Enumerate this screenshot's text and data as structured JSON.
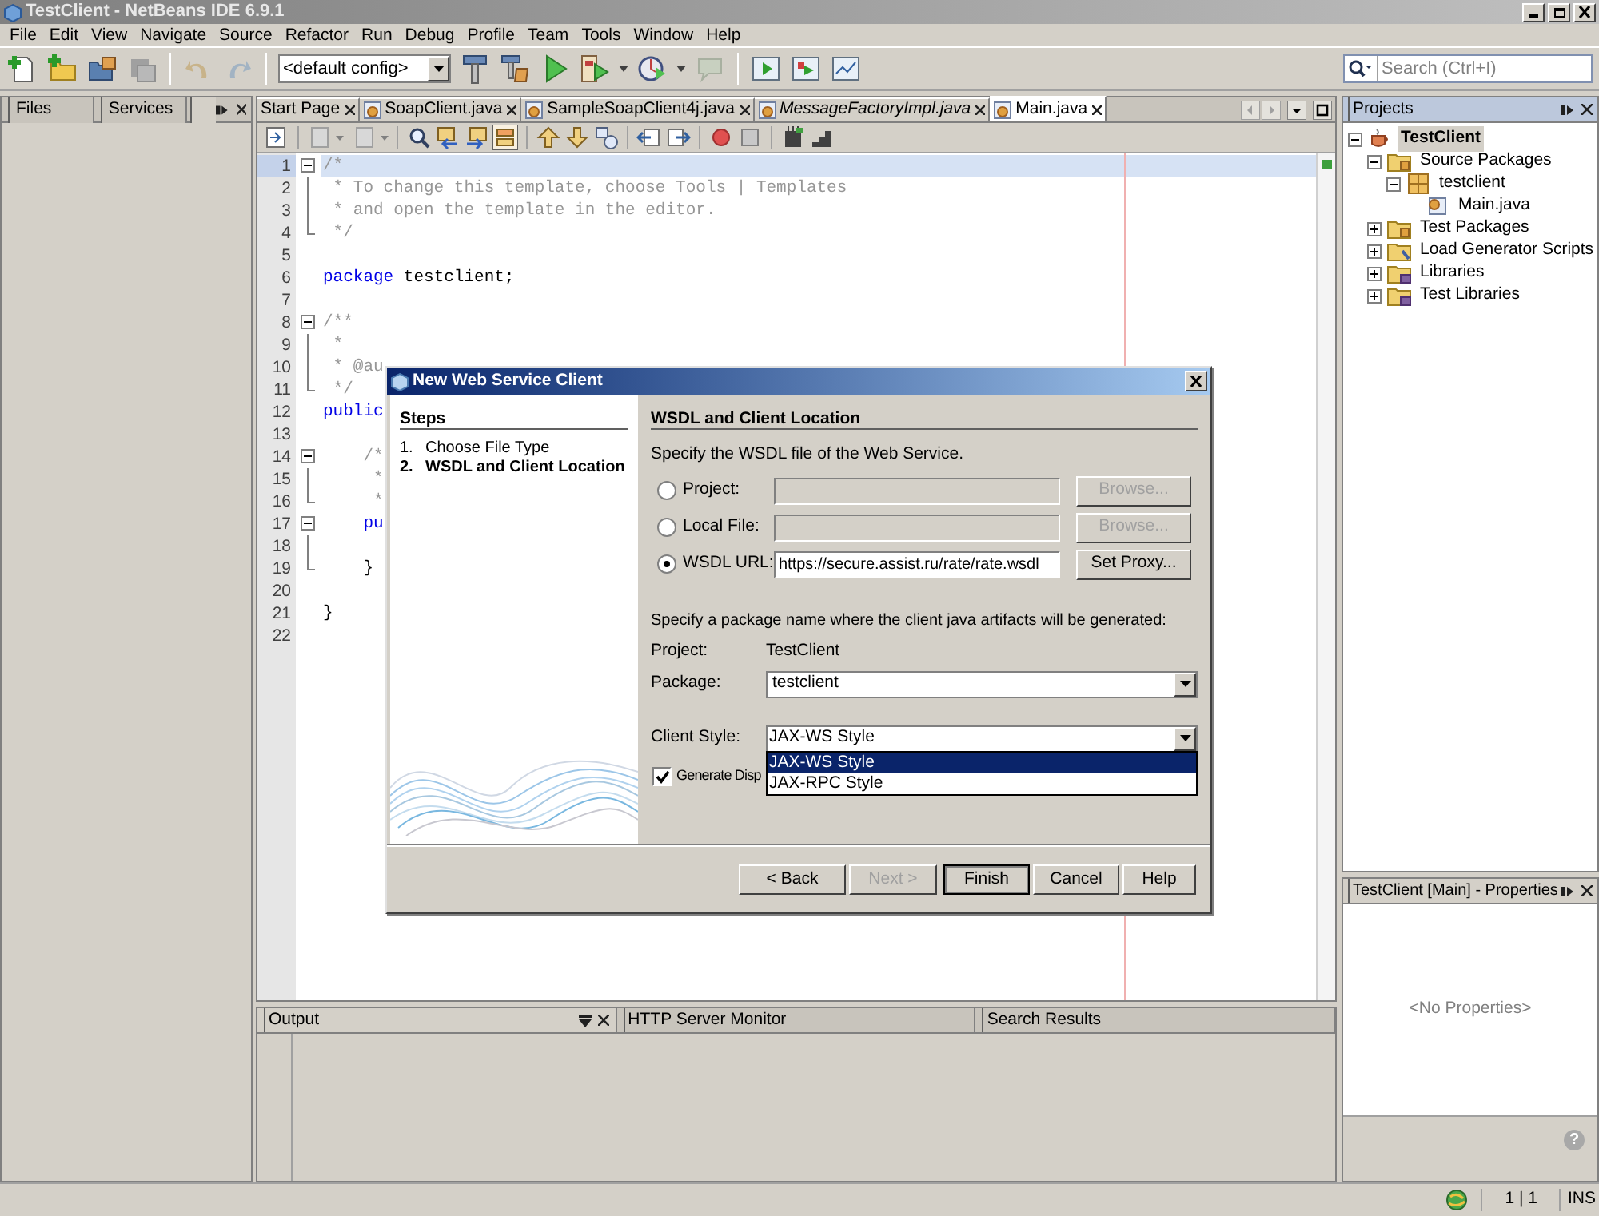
{
  "window": {
    "title": "TestClient - NetBeans IDE 6.9.1"
  },
  "menu": [
    "File",
    "Edit",
    "View",
    "Navigate",
    "Source",
    "Refactor",
    "Run",
    "Debug",
    "Profile",
    "Team",
    "Tools",
    "Window",
    "Help"
  ],
  "toolbar": {
    "config": "<default config>",
    "search_placeholder": "Search (Ctrl+I)"
  },
  "left_panel": {
    "tabs": [
      "Files",
      "Services"
    ]
  },
  "editor": {
    "tabs": [
      {
        "label": "Start Page",
        "italic": false,
        "selected": false,
        "icon": false
      },
      {
        "label": "SoapClient.java",
        "italic": false,
        "selected": false,
        "icon": true
      },
      {
        "label": "SampleSoapClient4j.java",
        "italic": false,
        "selected": false,
        "icon": true
      },
      {
        "label": "MessageFactoryImpl.java",
        "italic": true,
        "selected": false,
        "icon": true
      },
      {
        "label": "Main.java",
        "italic": false,
        "selected": true,
        "icon": true
      }
    ],
    "lines": [
      {
        "number": "1",
        "kind": "fold-start",
        "current": true,
        "tokens": [
          {
            "kind": "comment",
            "text": "/*"
          }
        ]
      },
      {
        "number": "2",
        "kind": "fold-body",
        "current": false,
        "tokens": [
          {
            "kind": "comment",
            "text": " * To change this template, choose Tools | Templates"
          }
        ]
      },
      {
        "number": "3",
        "kind": "fold-body",
        "current": false,
        "tokens": [
          {
            "kind": "comment",
            "text": " * and open the template in the editor."
          }
        ]
      },
      {
        "number": "4",
        "kind": "fold-end",
        "current": false,
        "tokens": [
          {
            "kind": "comment",
            "text": " */"
          }
        ]
      },
      {
        "number": "5",
        "kind": "plain",
        "current": false
      },
      {
        "number": "6",
        "kind": "plain",
        "current": false,
        "tokens": [
          {
            "kind": "keyword",
            "text": "package"
          },
          {
            "kind": "plain",
            "text": " testclient;"
          }
        ]
      },
      {
        "number": "7",
        "kind": "plain",
        "current": false
      },
      {
        "number": "8",
        "kind": "fold-start",
        "current": false,
        "tokens": [
          {
            "kind": "comment",
            "text": "/**"
          }
        ]
      },
      {
        "number": "9",
        "kind": "fold-body",
        "current": false,
        "tokens": [
          {
            "kind": "comment",
            "text": " *"
          }
        ]
      },
      {
        "number": "10",
        "kind": "fold-body",
        "current": false,
        "tokens": [
          {
            "kind": "comment",
            "text": " * @au"
          }
        ]
      },
      {
        "number": "11",
        "kind": "fold-end",
        "current": false,
        "tokens": [
          {
            "kind": "comment",
            "text": " */"
          }
        ]
      },
      {
        "number": "12",
        "kind": "plain",
        "current": false,
        "tokens": [
          {
            "kind": "keyword",
            "text": "public"
          }
        ]
      },
      {
        "number": "13",
        "kind": "plain",
        "current": false
      },
      {
        "number": "14",
        "kind": "fold-start",
        "current": false,
        "tokens": [
          {
            "kind": "comment",
            "text": "    /*"
          }
        ]
      },
      {
        "number": "15",
        "kind": "fold-body",
        "current": false,
        "tokens": [
          {
            "kind": "comment",
            "text": "     *"
          }
        ]
      },
      {
        "number": "16",
        "kind": "fold-end",
        "current": false,
        "tokens": [
          {
            "kind": "comment",
            "text": "     *"
          }
        ]
      },
      {
        "number": "17",
        "kind": "fold-start",
        "current": false,
        "tokens": [
          {
            "kind": "keyword",
            "text": "    pu"
          }
        ]
      },
      {
        "number": "18",
        "kind": "fold-body",
        "current": false
      },
      {
        "number": "19",
        "kind": "fold-end",
        "current": false,
        "tokens": [
          {
            "kind": "plain",
            "text": "    }"
          }
        ]
      },
      {
        "number": "20",
        "kind": "plain",
        "current": false
      },
      {
        "number": "21",
        "kind": "plain",
        "current": false,
        "tokens": [
          {
            "kind": "plain",
            "text": "}"
          }
        ]
      },
      {
        "number": "22",
        "kind": "plain",
        "current": false
      }
    ]
  },
  "output_panel": {
    "tabs": [
      {
        "label": "Output",
        "selected": true
      },
      {
        "label": "HTTP Server Monitor",
        "selected": false
      },
      {
        "label": "Search Results",
        "selected": false
      }
    ]
  },
  "projects": {
    "title": "Projects",
    "tree": [
      {
        "label": "TestClient",
        "kind": "project",
        "selected": true,
        "expanded": true,
        "children": [
          {
            "label": "Source Packages",
            "kind": "source-folder",
            "selected": false,
            "expanded": true,
            "children": [
              {
                "label": "testclient",
                "kind": "package",
                "selected": false,
                "expanded": true,
                "children": [
                  {
                    "label": "Main.java",
                    "kind": "java",
                    "selected": false
                  }
                ]
              }
            ]
          },
          {
            "label": "Test Packages",
            "kind": "source-folder",
            "selected": false,
            "expanded": false
          },
          {
            "label": "Load Generator Scripts",
            "kind": "script-folder",
            "selected": false,
            "expanded": false
          },
          {
            "label": "Libraries",
            "kind": "library-folder",
            "selected": false,
            "expanded": false
          },
          {
            "label": "Test Libraries",
            "kind": "library-folder",
            "selected": false,
            "expanded": false
          }
        ]
      }
    ]
  },
  "properties": {
    "title": "TestClient [Main] - Properties",
    "empty_text": "<No Properties>",
    "help": "?"
  },
  "status_bar": {
    "position": "1 | 1",
    "mode": "INS"
  },
  "dialog": {
    "title": "New Web Service Client",
    "steps_heading": "Steps",
    "steps": [
      {
        "number": "1.",
        "label": "Choose File Type",
        "selected": false
      },
      {
        "number": "2.",
        "label": "WSDL and Client Location",
        "selected": true
      }
    ],
    "heading": "WSDL and Client Location",
    "wsdl_hint": "Specify the WSDL file of the Web Service.",
    "sources": [
      {
        "label": "Project:",
        "selected": false,
        "button": "Browse...",
        "button_disabled": true
      },
      {
        "label": "Local File:",
        "selected": false,
        "button": "Browse...",
        "button_disabled": true
      },
      {
        "label": "WSDL URL:",
        "selected": true,
        "value": "https://secure.assist.ru/rate/rate.wsdl",
        "button": "Set Proxy...",
        "button_disabled": false
      }
    ],
    "package_hint": "Specify a package name where the client java artifacts will be generated:",
    "project_label": "Project:",
    "project_value": "TestClient",
    "package_label": "Package:",
    "package_value": "testclient",
    "style_label": "Client Style:",
    "style_value": "JAX-WS Style",
    "style_options": [
      {
        "label": "JAX-WS Style",
        "selected": true
      },
      {
        "label": "JAX-RPC Style",
        "selected": false
      }
    ],
    "checkbox": {
      "label": "Generate Disp",
      "checked": true
    },
    "buttons": [
      {
        "label": "< Back",
        "disabled": false,
        "default": false
      },
      {
        "label": "Next >",
        "disabled": true,
        "default": false
      },
      {
        "label": "Finish",
        "disabled": false,
        "default": true
      },
      {
        "label": "Cancel",
        "disabled": false,
        "default": false
      },
      {
        "label": "Help",
        "disabled": false,
        "default": false
      }
    ]
  }
}
